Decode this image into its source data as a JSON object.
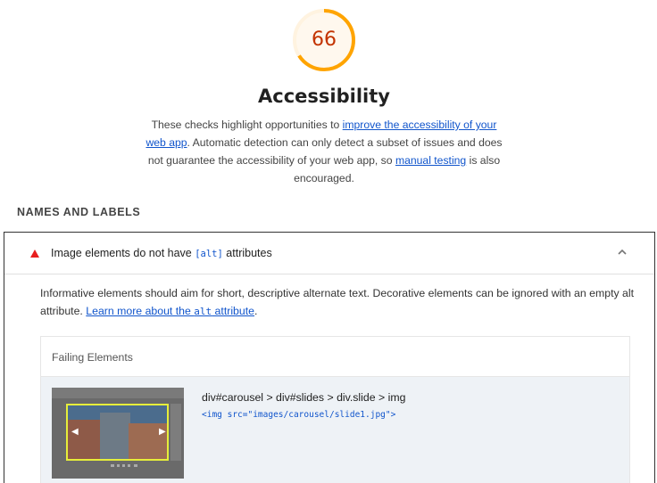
{
  "score": {
    "value": "66",
    "fraction": 0.66,
    "color": "#c33300",
    "ring_color": "#ffa400",
    "track_color": "#fff3e0"
  },
  "category": {
    "title": "Accessibility",
    "description": {
      "part1": "These checks highlight opportunities to ",
      "link1": "improve the accessibility of your web app",
      "part2": ". Automatic detection can only detect a subset of issues and does not guarantee the accessibility of your web app, so ",
      "link2": "manual testing",
      "part3": " is also encouraged."
    }
  },
  "section": {
    "heading": "Names and Labels"
  },
  "audit": {
    "status_icon": "fail-triangle-icon",
    "status_color": "#e81e1e",
    "title_before": "Image elements do not have ",
    "title_code": "[alt]",
    "title_after": " attributes",
    "expand_icon": "chevron-up-icon",
    "description_text": "Informative elements should aim for short, descriptive alternate text. Decorative elements can be ignored with an empty alt attribute. ",
    "learn_more_before": "Learn more about the ",
    "learn_more_code": "alt",
    "learn_more_after": " attribute",
    "description_end": ".",
    "details": {
      "header": "Failing Elements",
      "items": [
        {
          "selector": "div#carousel > div#slides > div.slide > img",
          "snippet": "<img src=\"images/carousel/slide1.jpg\">",
          "thumbnail": "element-screenshot"
        }
      ]
    }
  }
}
